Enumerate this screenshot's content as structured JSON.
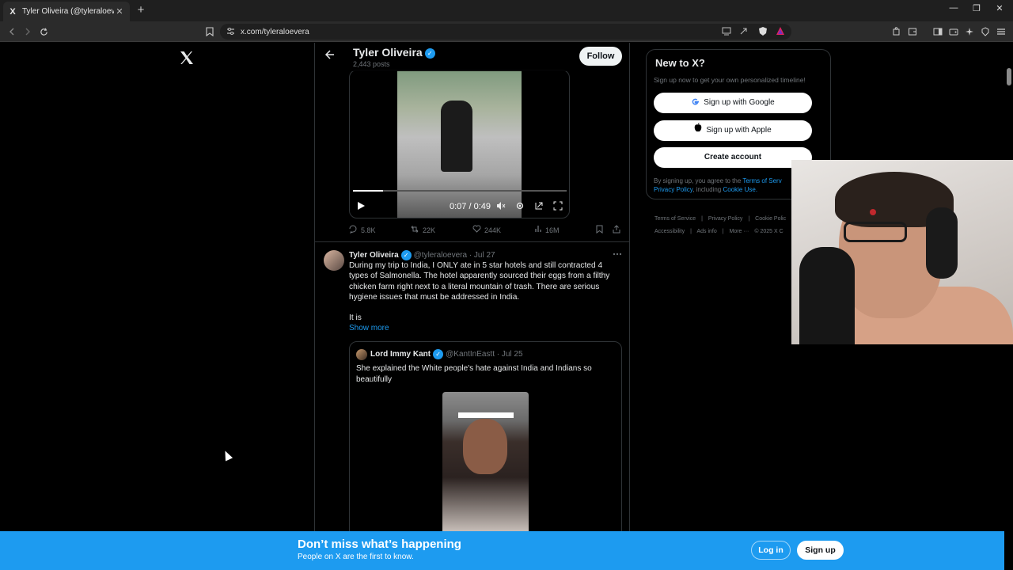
{
  "browser": {
    "tab_title": "Tyler Oliveira (@tyleraloevera) /",
    "tab_favicon": "X",
    "tab_close": "✕",
    "new_tab": "+",
    "url": "x.com/tyleraloevera",
    "min": "—",
    "max": "❐",
    "close": "✕"
  },
  "header": {
    "name": "Tyler Oliveira",
    "posts": "2,443 posts",
    "follow": "Follow"
  },
  "video": {
    "time": "0:07 / 0:49",
    "progress": 0.14
  },
  "video_actions": {
    "replies": "5.8K",
    "reposts": "22K",
    "likes": "244K",
    "views": "16M"
  },
  "tweet": {
    "name": "Tyler Oliveira",
    "handle": "@tyleraloevera · Jul 27",
    "body_p1": "During my trip to India, I ONLY ate in 5 star hotels and still contracted 4 types of Salmonella. The hotel apparently sourced their eggs from a filthy chicken farm right next to a literal mountain of trash. There are serious hygiene issues that must be addressed in India.",
    "body_p2": "It is",
    "show_more": "Show more"
  },
  "quote": {
    "name": "Lord Immy Kant",
    "handle": "@KantInEastt · Jul 25",
    "text": "She explained the White people's hate against India and Indians so beautifully"
  },
  "sidebar": {
    "title": "New to X?",
    "subtitle": "Sign up now to get your own personalized timeline!",
    "google": "Sign up with Google",
    "apple": "Sign up with Apple",
    "create": "Create account",
    "legal_prefix": "By signing up, you agree to the",
    "terms": "Terms of Serv",
    "privacy": "Privacy Policy",
    "legal_mid": ", including",
    "cookie": "Cookie Use."
  },
  "footer_links": [
    "Terms of Service",
    "|",
    "Privacy Policy",
    "|",
    "Cookie Polic",
    "Accessibility",
    "|",
    "Ads info",
    "|",
    "More ···",
    "© 2025 X C"
  ],
  "bottom_bar": {
    "title": "Don’t miss what’s happening",
    "subtitle": "People on X are the first to know.",
    "login": "Log in",
    "signup": "Sign up"
  },
  "colors": {
    "accent": "#1d9bf0",
    "background": "#000000"
  }
}
